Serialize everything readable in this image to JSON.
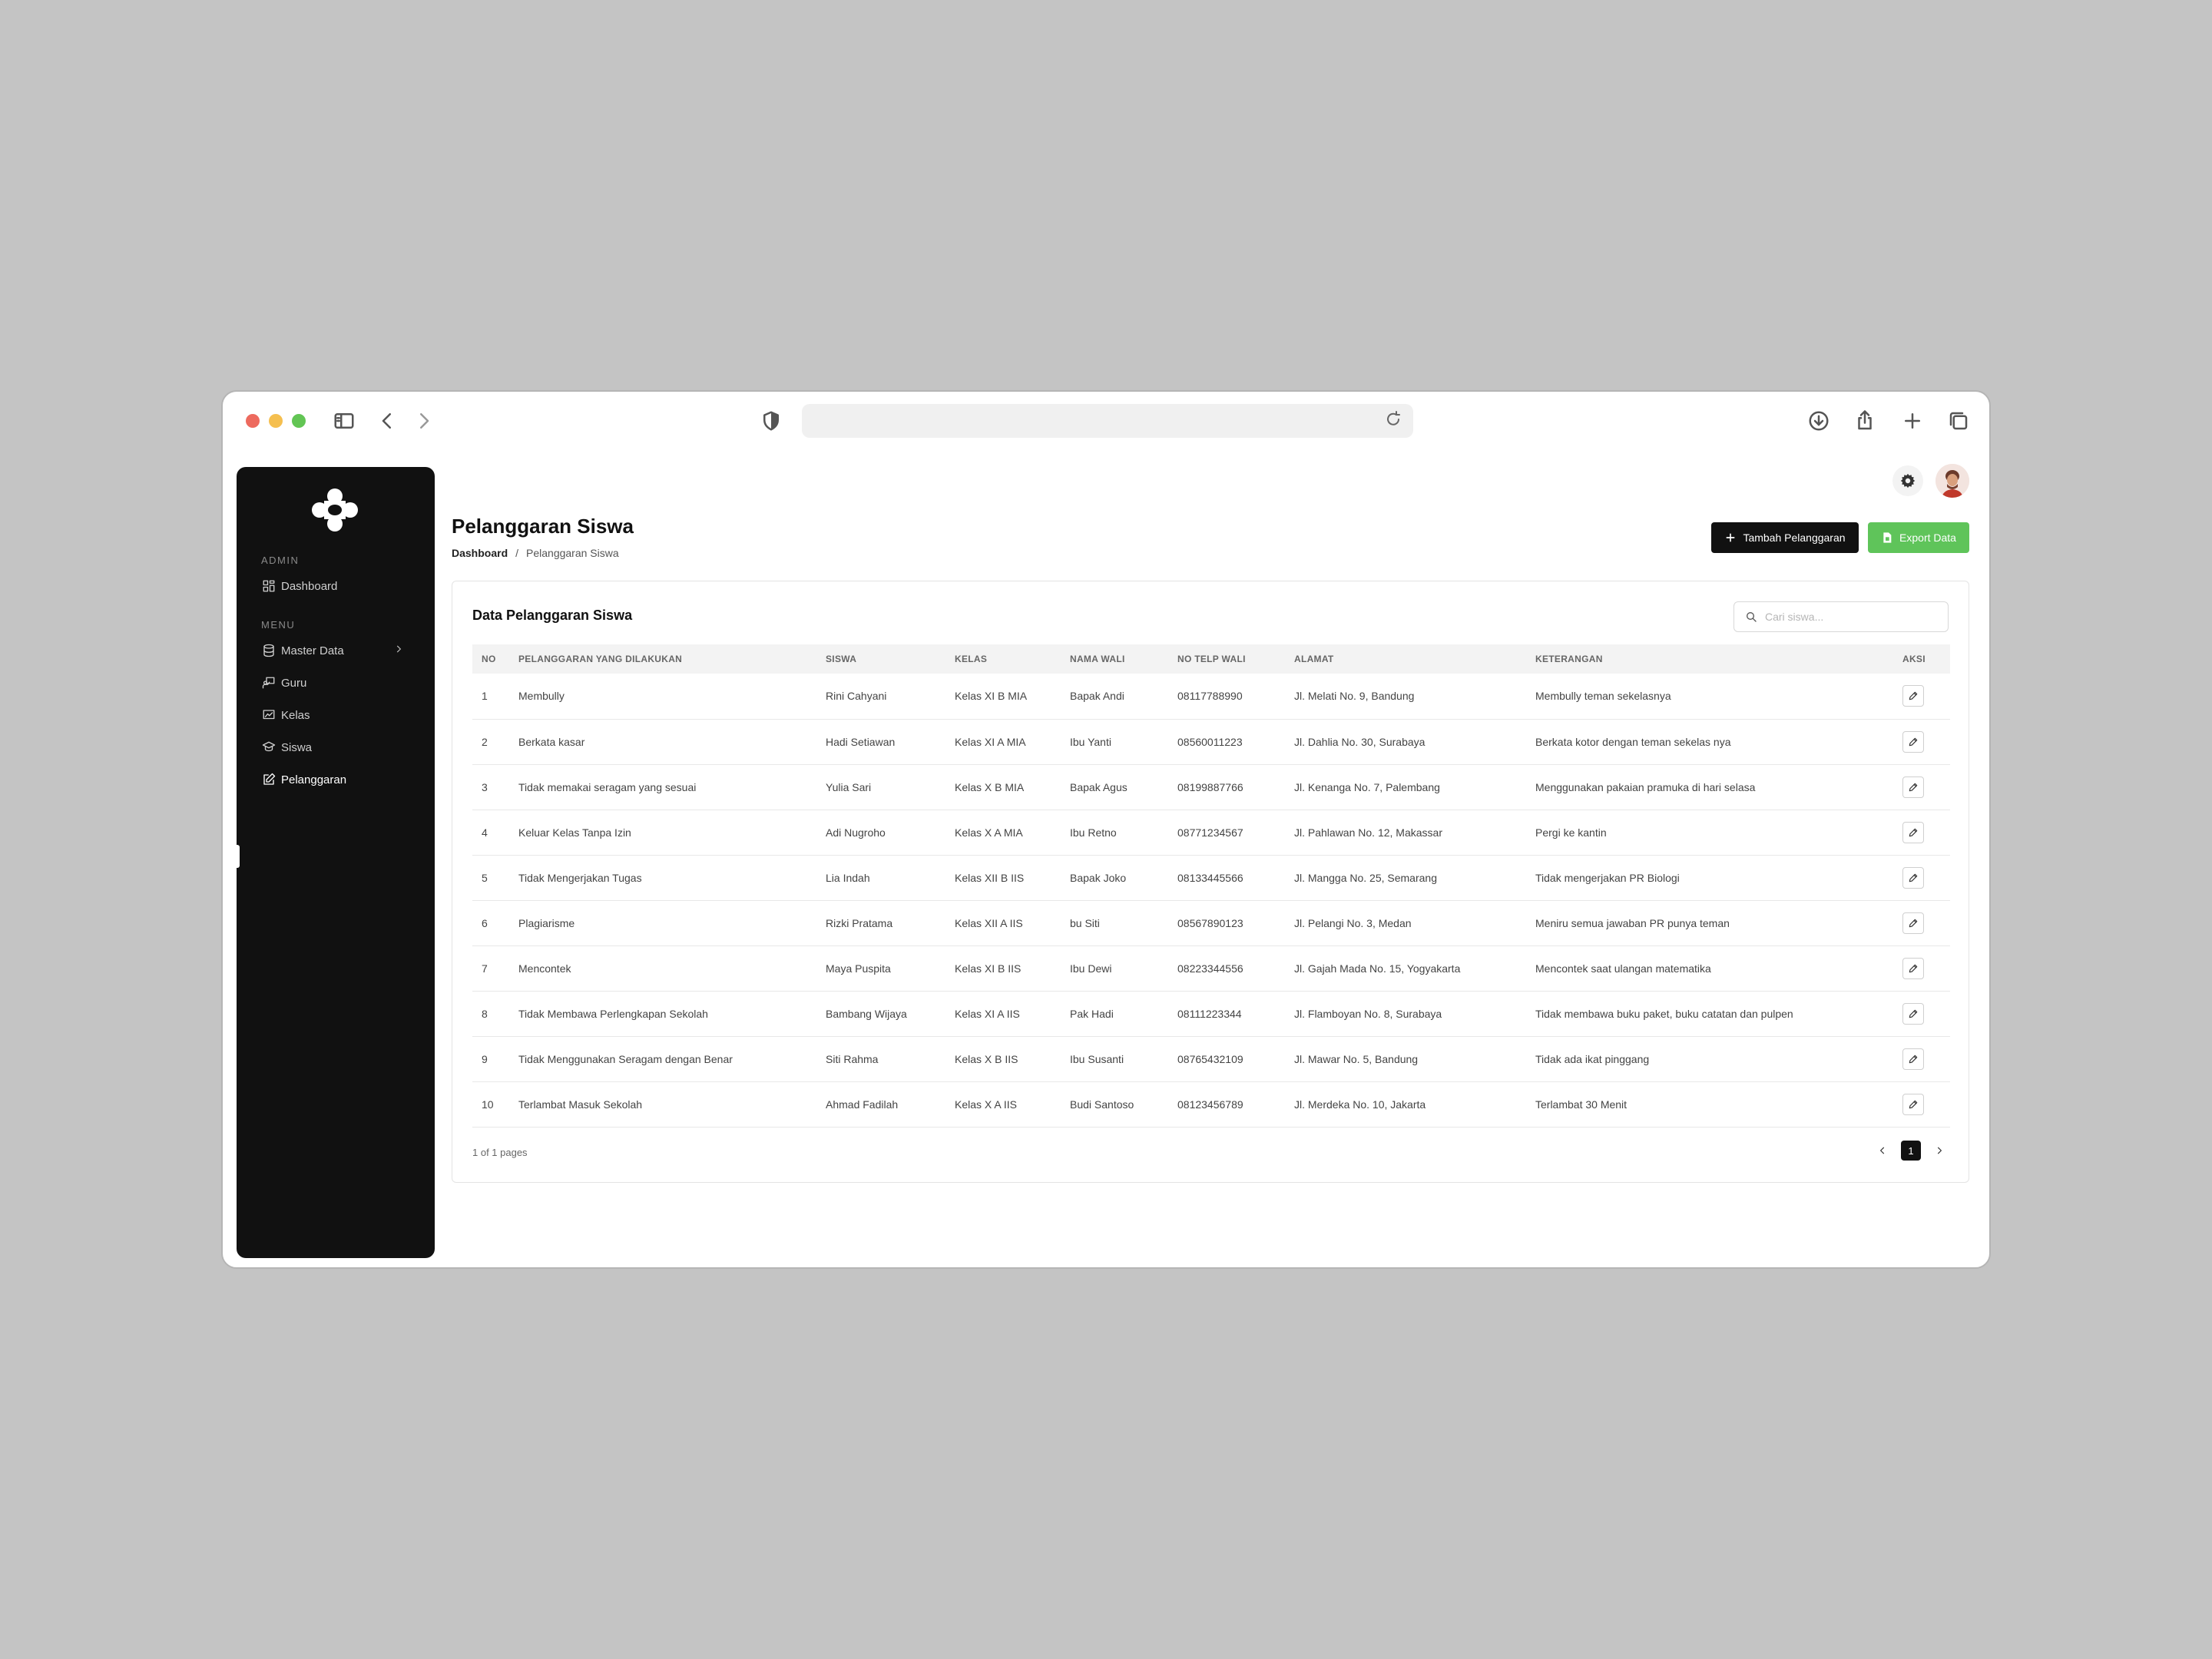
{
  "app": {
    "page_title": "Pelanggaran Siswa",
    "breadcrumb": [
      "Dashboard",
      "/",
      "Pelanggaran Siswa"
    ]
  },
  "sidebar": {
    "admin_label": "ADMIN",
    "menu_label": "MENU",
    "items": [
      {
        "label": "Dashboard",
        "icon": "dashboard-icon"
      },
      {
        "label": "Master Data",
        "icon": "database-icon"
      },
      {
        "label": "Guru",
        "icon": "teacher-icon"
      },
      {
        "label": "Kelas",
        "icon": "classroom-icon"
      },
      {
        "label": "Siswa",
        "icon": "student-icon"
      },
      {
        "label": "Pelanggaran",
        "icon": "edit-note-icon"
      }
    ],
    "active": "Pelanggaran"
  },
  "actions": {
    "add_label": "Tambah Pelanggaran",
    "export_label": "Export Data"
  },
  "card": {
    "title": "Data Pelanggaran Siswa",
    "search_placeholder": "Cari siswa..."
  },
  "table": {
    "columns": [
      "NO",
      "PELANGGARAN YANG DILAKUKAN",
      "SISWA",
      "KELAS",
      "NAMA WALI",
      "NO TELP WALI",
      "ALAMAT",
      "KETERANGAN",
      "AKSI"
    ],
    "rows": [
      [
        "1",
        "Membully",
        "Rini Cahyani",
        "Kelas XI B MIA",
        "Bapak Andi",
        "08117788990",
        "Jl. Melati No. 9, Bandung",
        "Membully teman sekelasnya"
      ],
      [
        "2",
        "Berkata kasar",
        "Hadi Setiawan",
        "Kelas XI A MIA",
        "Ibu Yanti",
        "08560011223",
        "Jl. Dahlia No. 30, Surabaya",
        "Berkata kotor dengan teman sekelas nya"
      ],
      [
        "3",
        "Tidak memakai seragam yang sesuai",
        "Yulia Sari",
        "Kelas X B MIA",
        "Bapak Agus",
        "08199887766",
        "Jl. Kenanga No. 7, Palembang",
        "Menggunakan pakaian pramuka di hari selasa"
      ],
      [
        "4",
        "Keluar Kelas Tanpa Izin",
        "Adi Nugroho",
        "Kelas X A MIA",
        "Ibu Retno",
        "08771234567",
        "Jl. Pahlawan No. 12, Makassar",
        "Pergi ke kantin"
      ],
      [
        "5",
        "Tidak Mengerjakan Tugas",
        "Lia Indah",
        "Kelas XII B IIS",
        "Bapak Joko",
        "08133445566",
        "Jl. Mangga No. 25, Semarang",
        "Tidak mengerjakan PR Biologi"
      ],
      [
        "6",
        "Plagiarisme",
        "Rizki Pratama",
        "Kelas XII A IIS",
        "bu Siti",
        "08567890123",
        "Jl. Pelangi No. 3, Medan",
        "Meniru semua jawaban PR punya teman"
      ],
      [
        "7",
        "Mencontek",
        "Maya Puspita",
        "Kelas XI B IIS",
        "Ibu Dewi",
        "08223344556",
        "Jl. Gajah Mada No. 15, Yogyakarta",
        "Mencontek saat ulangan matematika"
      ],
      [
        "8",
        "Tidak Membawa Perlengkapan Sekolah",
        "Bambang Wijaya",
        "Kelas XI A IIS",
        "Pak Hadi",
        "08111223344",
        "Jl. Flamboyan No. 8, Surabaya",
        "Tidak membawa buku paket, buku catatan dan pulpen"
      ],
      [
        "9",
        "Tidak Menggunakan Seragam dengan Benar",
        "Siti Rahma",
        "Kelas X B IIS",
        "Ibu Susanti",
        "08765432109",
        "Jl. Mawar No. 5, Bandung",
        "Tidak ada ikat pinggang"
      ],
      [
        "10",
        "Terlambat Masuk Sekolah",
        "Ahmad Fadilah",
        "Kelas X A IIS",
        "Budi Santoso",
        "08123456789",
        "Jl. Merdeka No. 10, Jakarta",
        "Terlambat 30 Menit"
      ]
    ]
  },
  "pagination": {
    "info": "1 of 1 pages",
    "current": "1"
  },
  "colors": {
    "sidebar_bg": "#111111",
    "primary_button": "#111111",
    "export_button": "#5fc45a"
  }
}
